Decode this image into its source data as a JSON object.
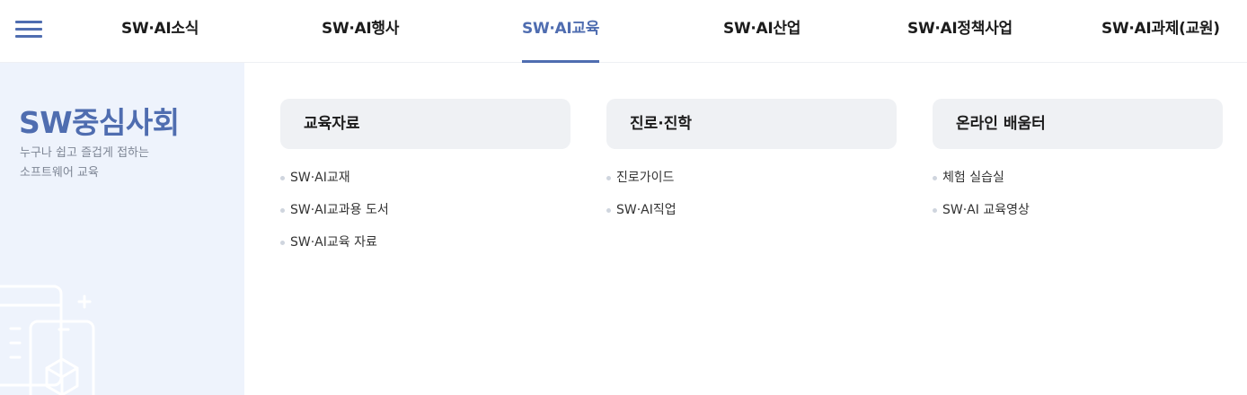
{
  "nav": {
    "menu_icon": "hamburger-menu-icon",
    "items": [
      {
        "label": "SW·AI소식"
      },
      {
        "label": "SW·AI행사"
      },
      {
        "label": "SW·AI교육"
      },
      {
        "label": "SW·AI산업"
      },
      {
        "label": "SW·AI정책사업"
      },
      {
        "label": "SW·AI과제(교원)"
      }
    ],
    "active_index": 2
  },
  "sidebar": {
    "title": "SW중심사회",
    "subtitle_line1": "누구나 쉽고 즐겁게 접하는",
    "subtitle_line2": "소프트웨어 교육",
    "decoration_icon": "document-box-illustration-icon"
  },
  "columns": [
    {
      "heading": "교육자료",
      "items": [
        "SW·AI교재",
        "SW·AI교과용 도서",
        "SW·AI교육 자료"
      ]
    },
    {
      "heading": "진로·진학",
      "items": [
        "진로가이드",
        "SW·AI직업"
      ]
    },
    {
      "heading": "온라인 배움터",
      "items": [
        "체험 실습실",
        "SW·AI 교육영상"
      ]
    }
  ],
  "colors": {
    "accent": "#4f6db0",
    "panel_bg": "#eef3fc",
    "heading_bg": "#eff1f4",
    "text": "#1c1c1c",
    "muted": "#7d8594",
    "bullet": "#cfd5de"
  }
}
